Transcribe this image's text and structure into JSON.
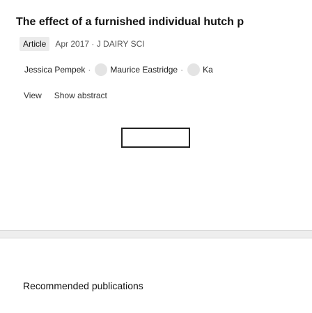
{
  "publication": {
    "title": "The effect of a furnished individual hutch p",
    "type_badge": "Article",
    "meta": "Apr 2017 · J DAIRY SCI",
    "authors": [
      {
        "name": "Jessica Pempek",
        "separator": "·"
      },
      {
        "name": "Maurice Eastridge",
        "separator": "·"
      },
      {
        "name": "Ka",
        "separator": ""
      }
    ],
    "actions": {
      "view_label": "View",
      "abstract_label": "Show abstract"
    }
  },
  "recommended": {
    "title": "Recommended publications"
  }
}
